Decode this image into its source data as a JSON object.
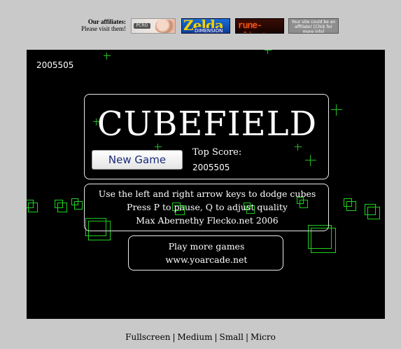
{
  "affiliates": {
    "heading": "Our affiliates:",
    "subheading": "Please visit them!",
    "banners": [
      {
        "label": "PCRO",
        "icon": "pcro-banner"
      },
      {
        "label": "Zelda",
        "sub": "DIMENSION",
        "icon": "zelda-dimension-banner"
      },
      {
        "label": "rune-client",
        "icon": "rune-client-banner"
      },
      {
        "label": "Your site could be an affiliate! [Click for more info]",
        "icon": "affiliate-ad-banner"
      }
    ]
  },
  "game": {
    "score": "2005505",
    "title": "CUBEFIELD",
    "new_game_label": "New Game",
    "top_score_label": "Top Score:",
    "top_score_value": "2005505",
    "instructions": [
      "Use the left and right arrow keys to dodge cubes",
      "Press P to pause, Q to adjust quality",
      "Max Abernethy Flecko.net 2006"
    ],
    "more_games": [
      "Play more games",
      "www.yoarcade.net"
    ],
    "colors": {
      "background": "#000000",
      "cubes": "#1ed21e",
      "text": "#ffffff"
    }
  },
  "size_links": [
    "Fullscreen",
    "Medium",
    "Small",
    "Micro"
  ]
}
